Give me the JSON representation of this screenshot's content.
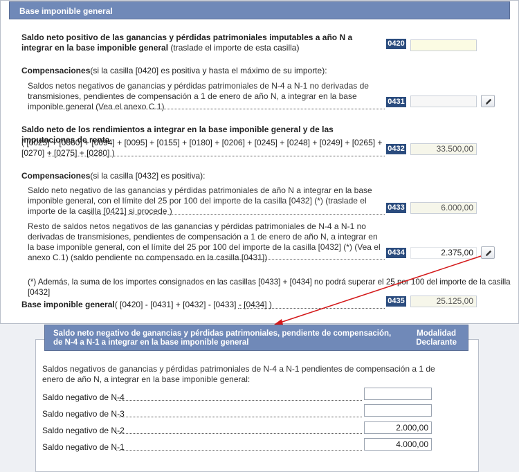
{
  "main": {
    "header": "Base imponible general",
    "row1": {
      "bold": "Saldo neto positivo de las ganancias y pérdidas patrimoniales imputables a año N a integrar en la base imponible general",
      "normal": " (traslade el importe de esta casilla)",
      "code": "0420",
      "value": ""
    },
    "comp1": {
      "bold": "Compensaciones",
      "normal": "(si la casilla [0420] es positiva y hasta el máximo de su importe):"
    },
    "row2": {
      "text": "Saldos netos negativos de ganancias y pérdidas patrimoniales de N-4 a N-1 no derivadas de transmisiones, pendientes de compensación a 1 de enero de año N, a integrar en la base imponible general (Vea el anexo C.1)",
      "code": "0431",
      "value": ""
    },
    "row3": {
      "bold": "Saldo neto de los rendimientos a integrar en la base imponible general y de las imputaciones de renta",
      "formula": "( [0025] + [0060] + [0094] + [0095] + [0155] + [0180] + [0206] + [0245] + [0248] + [0249] + [0265] + [0270] + [0275] + [0280] )",
      "code": "0432",
      "value": "33.500,00"
    },
    "comp2": {
      "bold": "Compensaciones",
      "normal": "(si la casilla [0432] es positiva):"
    },
    "row4": {
      "text": "Saldo neto negativo de las ganancias y pérdidas patrimoniales de año N a integrar en la base imponible general, con el límite del 25 por 100 del importe de la casilla [0432] (*) (traslade el importe de la casilla [0421] si procede )",
      "code": "0433",
      "value": "6.000,00"
    },
    "row5": {
      "text": "Resto de saldos netos negativos de las ganancias y pérdidas patrimoniales de N-4 a N-1 no derivadas de transmisiones, pendientes de compensación a 1 de enero de año N, a integrar en la base imponible general, con el límite del 25 por 100 del importe de la casilla [0432] (*) (Vea el anexo C.1) (saldo pendiente no compensado en la casilla [0431])",
      "code": "0434",
      "value": "2.375,00"
    },
    "note": "(*) Además, la suma de los importes consignados en las casillas [0433] + [0434] no podrá superar el 25 por 100 del importe de la casilla [0432]",
    "row6": {
      "bold": "Base imponible general",
      "formula": "( [0420] - [0431] + [0432] - [0433] - [0434] )",
      "code": "0435",
      "value": "25.125,00"
    }
  },
  "popup": {
    "title": "Saldo neto negativo de ganancias y pérdidas patrimoniales, pendiente de compensación, de N-4 a N-1 a integrar en la base imponible general",
    "mode_line1": "Modalidad",
    "mode_line2": "Declarante",
    "intro": "Saldos negativos de ganancias y pérdidas patrimoniales de N-4 a N-1 pendientes de compensación a 1 de enero de año N, a integrar en la base imponible general:",
    "rows": [
      {
        "label": "Saldo negativo de N-4",
        "value": ""
      },
      {
        "label": "Saldo negativo de N-3",
        "value": ""
      },
      {
        "label": "Saldo negativo de N-2",
        "value": "2.000,00"
      },
      {
        "label": "Saldo negativo de N-1",
        "value": "4.000,00"
      }
    ]
  },
  "colors": {
    "header": "#7089b8",
    "code_badge": "#2b4c7e",
    "arrow": "#d4191a"
  },
  "icons": {
    "edit": "pencil-icon",
    "link": "arrow"
  }
}
